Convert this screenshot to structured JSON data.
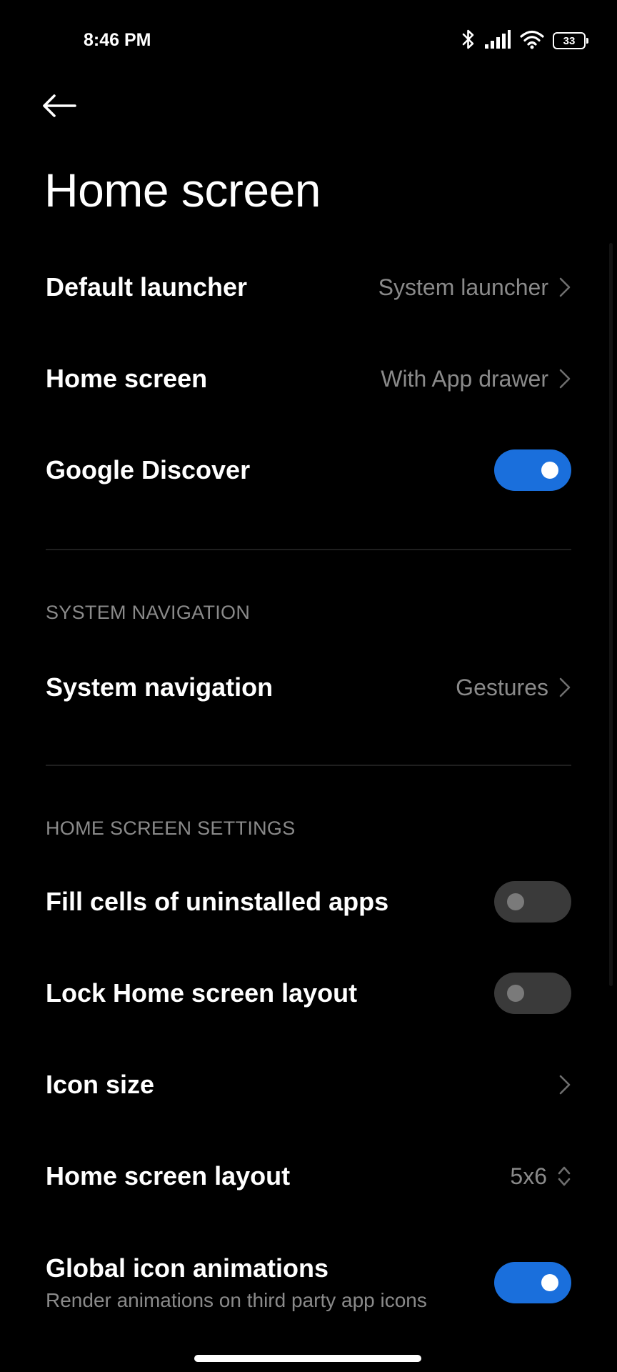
{
  "status_bar": {
    "time": "8:46 PM",
    "battery_level": "33",
    "icons": [
      "bluetooth-icon",
      "cellular-signal-icon",
      "wifi-icon",
      "battery-icon"
    ]
  },
  "header": {
    "back_icon": "arrow-left-icon",
    "title": "Home screen"
  },
  "settings": {
    "default_launcher": {
      "label": "Default launcher",
      "value": "System launcher"
    },
    "home_screen": {
      "label": "Home screen",
      "value": "With App drawer"
    },
    "google_discover": {
      "label": "Google Discover",
      "enabled": true
    }
  },
  "system_navigation_section": {
    "header": "SYSTEM NAVIGATION",
    "system_navigation": {
      "label": "System navigation",
      "value": "Gestures"
    }
  },
  "home_screen_settings_section": {
    "header": "HOME SCREEN SETTINGS",
    "fill_cells": {
      "label": "Fill cells of uninstalled apps",
      "enabled": false
    },
    "lock_layout": {
      "label": "Lock Home screen layout",
      "enabled": false
    },
    "icon_size": {
      "label": "Icon size"
    },
    "home_screen_layout": {
      "label": "Home screen layout",
      "value": "5x6"
    },
    "global_icon_animations": {
      "label": "Global icon animations",
      "description": "Render animations on third party app icons",
      "enabled": true
    }
  },
  "colors": {
    "background": "#000000",
    "accent": "#1a6fdc",
    "secondary_text": "#8a8a8a",
    "toggle_off": "#3a3a3a"
  }
}
